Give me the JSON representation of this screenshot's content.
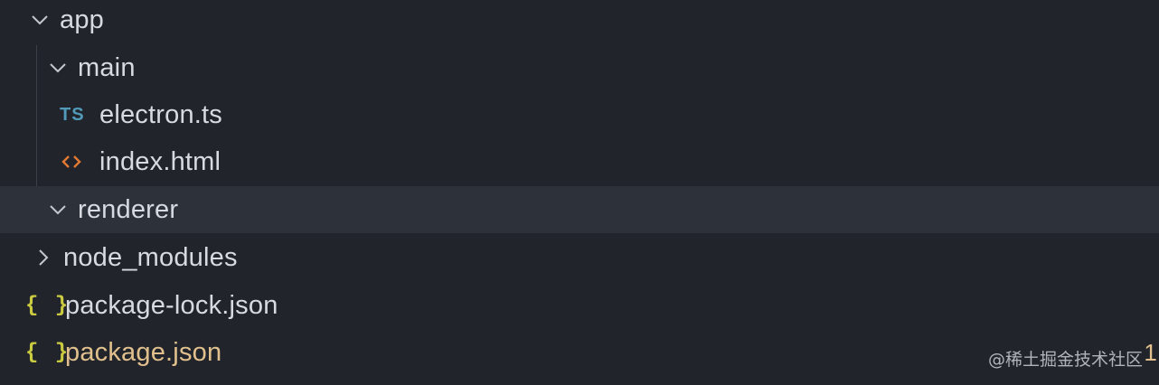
{
  "explorer": {
    "items": [
      {
        "label": "app",
        "kind": "folder",
        "expanded": true,
        "icon": "chevron-down-icon"
      },
      {
        "label": "main",
        "kind": "folder",
        "expanded": true,
        "icon": "chevron-down-icon"
      },
      {
        "label": "electron.ts",
        "kind": "file",
        "icon": "typescript-icon",
        "icon_text": "TS"
      },
      {
        "label": "index.html",
        "kind": "file",
        "icon": "html-icon"
      },
      {
        "label": "renderer",
        "kind": "folder",
        "expanded": true,
        "icon": "chevron-down-icon",
        "selected": true
      },
      {
        "label": "node_modules",
        "kind": "folder",
        "expanded": false,
        "icon": "chevron-right-icon"
      },
      {
        "label": "package-lock.json",
        "kind": "file",
        "icon": "json-icon",
        "icon_text": "{ }"
      },
      {
        "label": "package.json",
        "kind": "file",
        "icon": "json-icon",
        "icon_text": "{ }",
        "modified": true,
        "badge": "1"
      }
    ]
  },
  "watermark": "@稀土掘金技术社区",
  "colors": {
    "background": "#21252b",
    "selected_row": "#2c313a",
    "text": "#d7dae0",
    "modified": "#e2c08d",
    "typescript": "#519aba",
    "html": "#e37933",
    "json": "#cbcb41"
  }
}
